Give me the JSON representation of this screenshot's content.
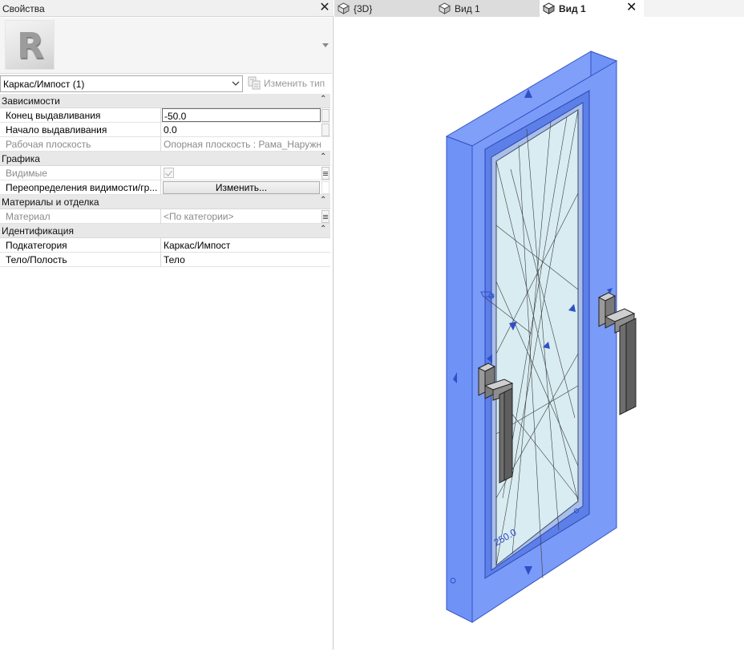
{
  "properties": {
    "title": "Свойства",
    "type_selector": {
      "logo_letter": "R"
    },
    "filter": {
      "selected": "Каркас/Импост (1)",
      "edit_type_label": "Изменить тип"
    },
    "groups": [
      {
        "label": "Зависимости",
        "rows": [
          {
            "name": "Конец выдавливания",
            "value": "-50.0"
          },
          {
            "name": "Начало выдавливания",
            "value": "0.0"
          },
          {
            "name": "Рабочая плоскость",
            "value": "Опорная плоскость : Рама_Наружн"
          }
        ]
      },
      {
        "label": "Графика",
        "rows": [
          {
            "name": "Видимые",
            "value": ""
          },
          {
            "name": "Переопределения видимости/гр...",
            "value": "Изменить..."
          }
        ]
      },
      {
        "label": "Материалы и отделка",
        "rows": [
          {
            "name": "Материал",
            "value": "<По категории>"
          }
        ]
      },
      {
        "label": "Идентификация",
        "rows": [
          {
            "name": "Подкатегория",
            "value": "Каркас/Импост"
          },
          {
            "name": "Тело/Полость",
            "value": "Тело"
          }
        ]
      }
    ]
  },
  "tabs": [
    {
      "label": "{3D}",
      "active": false
    },
    {
      "label": "Вид 1",
      "active": false
    },
    {
      "label": "Вид 1",
      "active": true
    }
  ],
  "viewport": {
    "dimension_label": "250.0",
    "selection_color": "#3b6cf5",
    "glass_color": "#d8ecf2",
    "handle_color": "#6e6e6e"
  }
}
